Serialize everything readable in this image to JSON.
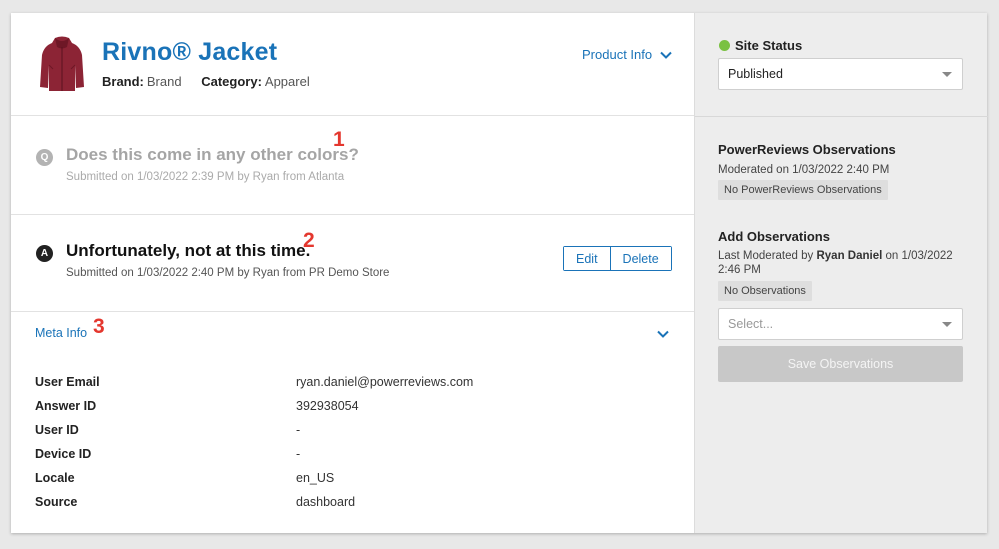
{
  "product": {
    "title": "Rivno® Jacket",
    "brand_label": "Brand:",
    "brand_value": "Brand",
    "category_label": "Category:",
    "category_value": "Apparel",
    "info_link": "Product Info"
  },
  "question": {
    "badge": "Q",
    "text": "Does this come in any other colors?",
    "submitted": "Submitted on 1/03/2022 2:39 PM by Ryan from Atlanta",
    "marker": "1"
  },
  "answer": {
    "badge": "A",
    "text": "Unfortunately, not at this time.",
    "submitted": "Submitted on 1/03/2022 2:40 PM by Ryan from PR Demo Store",
    "marker": "2",
    "edit_label": "Edit",
    "delete_label": "Delete"
  },
  "meta": {
    "link_label": "Meta Info",
    "marker": "3",
    "rows": [
      {
        "key": "User Email",
        "value": "ryan.daniel@powerreviews.com"
      },
      {
        "key": "Answer ID",
        "value": "392938054"
      },
      {
        "key": "User ID",
        "value": "-"
      },
      {
        "key": "Device ID",
        "value": "-"
      },
      {
        "key": "Locale",
        "value": "en_US"
      },
      {
        "key": "Source",
        "value": "dashboard"
      }
    ]
  },
  "sidebar": {
    "status_label": "Site Status",
    "status_value": "Published",
    "pr_obs_title": "PowerReviews Observations",
    "pr_obs_moderated": "Moderated on 1/03/2022 2:40 PM",
    "pr_obs_chip": "No PowerReviews Observations",
    "add_obs_title": "Add Observations",
    "add_obs_prefix": "Last Moderated by",
    "add_obs_user": "Ryan Daniel",
    "add_obs_suffix": "on 1/03/2022 2:46 PM",
    "add_obs_chip": "No Observations",
    "select_placeholder": "Select...",
    "save_label": "Save Observations"
  },
  "colors": {
    "accent": "#1a73b8",
    "status_dot": "#7ac142",
    "marker": "#e4372e"
  }
}
